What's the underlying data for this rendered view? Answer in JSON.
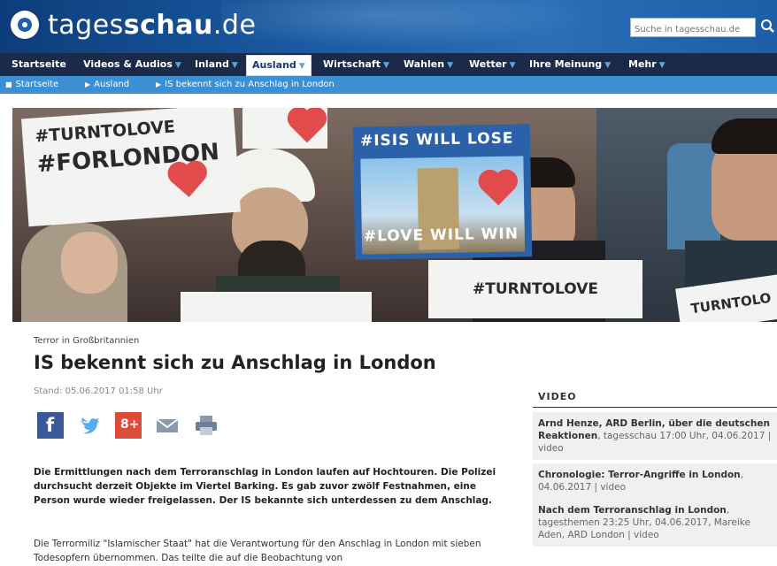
{
  "site": {
    "logo_light": "tages",
    "logo_bold": "schau",
    "logo_tld": ".de"
  },
  "search": {
    "placeholder": "Suche in tagesschau.de"
  },
  "nav": {
    "items": [
      {
        "label": "Startseite"
      },
      {
        "label": "Videos & Audios"
      },
      {
        "label": "Inland"
      },
      {
        "label": "Ausland"
      },
      {
        "label": "Wirtschaft"
      },
      {
        "label": "Wahlen"
      },
      {
        "label": "Wetter"
      },
      {
        "label": "Ihre Meinung"
      },
      {
        "label": "Mehr"
      }
    ]
  },
  "breadcrumb": [
    {
      "label": "Startseite"
    },
    {
      "label": "Ausland"
    },
    {
      "label": "IS bekennt sich zu Anschlag in London"
    }
  ],
  "hero": {
    "signs": {
      "turntolove_top": "#TURNTOLOVE",
      "forlondon": "#FORLONDON",
      "isis_will_lose": "#ISIS WILL LOSE",
      "love_will_win": "#LOVE WILL WIN",
      "turntolove_bottom": "#TURNTOLOVE",
      "turntolove_right": "TURNTOLO"
    }
  },
  "article": {
    "kicker": "Terror in Großbritannien",
    "title": "IS bekennt sich zu Anschlag in London",
    "stand": "Stand: 05.06.2017 01:58 Uhr",
    "lead": "Die Ermittlungen nach dem Terroranschlag in London laufen auf Hochtouren. Die Polizei durchsucht derzeit Objekte im Viertel Barking. Es gab zuvor zwölf Festnahmen, eine Person wurde wieder freigelassen. Der IS bekannte sich unterdessen zu dem Anschlag.",
    "body": "Die Terrormiliz \"Islamischer Staat\" hat die Verantwortung für den Anschlag in London mit sieben Todesopfern übernommen. Das teilte die auf die Beobachtung von"
  },
  "share": {
    "labels": [
      "f",
      "8+"
    ]
  },
  "video": {
    "heading": "VIDEO",
    "items": [
      {
        "title": "Arnd Henze, ARD Berlin, über die deutschen Reaktionen",
        "meta": ", tagesschau 17:00 Uhr, 04.06.2017 | video"
      },
      {
        "title": "Chronologie: Terror-Angriffe in London",
        "meta": ", 04.06.2017 | video"
      },
      {
        "title": "Nach dem Terroranschlag in London",
        "meta": ", tagesthemen 23:25 Uhr, 04.06.2017, Mareike Aden, ARD London | video"
      }
    ]
  },
  "colors": {
    "header_blue": "#1c5ea8",
    "nav_dark": "#1b2a48",
    "breadcrumb_blue": "#3d8fd4",
    "facebook": "#3b5998",
    "twitter": "#55acee",
    "googleplus": "#dd4b39"
  }
}
